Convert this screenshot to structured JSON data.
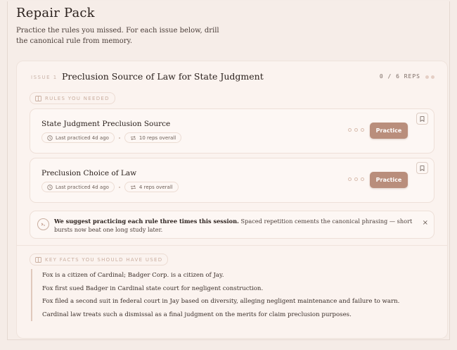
{
  "page": {
    "title": "Repair Pack",
    "subtitle": "Practice the rules you missed. For each issue below, drill the canonical rule from memory."
  },
  "issue": {
    "label": "ISSUE 1",
    "title": "Preclusion Source of Law for State Judgment",
    "reps": "0 / 6 REPS"
  },
  "rules_section": {
    "label": "RULES YOU NEEDED"
  },
  "rules": [
    {
      "name": "State Judgment Preclusion Source",
      "last_practiced": "Last practiced 4d ago",
      "reps": "10 reps overall",
      "practice_label": "Practice"
    },
    {
      "name": "Preclusion Choice of Law",
      "last_practiced": "Last practiced 4d ago",
      "reps": "4 reps overall",
      "practice_label": "Practice"
    }
  ],
  "suggestion": {
    "bold": "We suggest practicing each rule three times this session.",
    "text": " Spaced repetition cements the canonical phrasing — short bursts now beat one long study later.",
    "close": "×"
  },
  "facts_section": {
    "label": "KEY FACTS YOU SHOULD HAVE USED"
  },
  "facts": [
    "Fox is a citizen of Cardinal; Badger Corp. is a citizen of Jay.",
    "Fox first sued Badger in Cardinal state court for negligent construction.",
    "Fox filed a second suit in federal court in Jay based on diversity, alleging negligent maintenance and failure to warn.",
    "Cardinal law treats such a dismissal as a final judgment on the merits for claim preclusion purposes."
  ],
  "colors": {
    "accent": "#b98e7c",
    "background": "#f5ece7",
    "card": "#fbf3ef"
  }
}
